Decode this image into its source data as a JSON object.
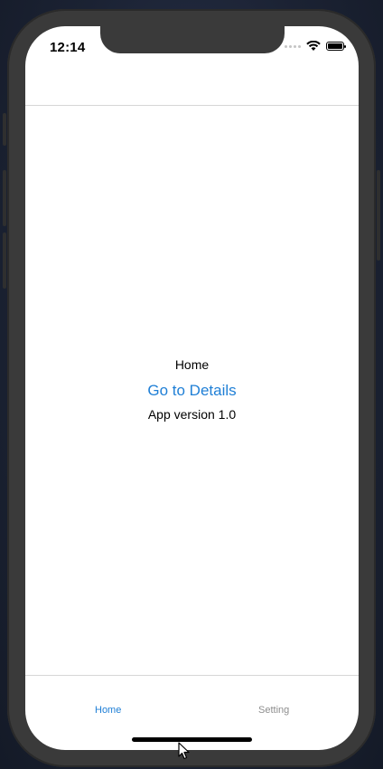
{
  "status_bar": {
    "time": "12:14"
  },
  "screen": {
    "title": "Home",
    "details_link": "Go to Details",
    "version_text": "App version 1.0"
  },
  "tab_bar": {
    "tabs": [
      {
        "label": "Home",
        "active": true
      },
      {
        "label": "Setting",
        "active": false
      }
    ]
  },
  "colors": {
    "accent": "#1f7fd6",
    "inactive_tab": "#8e8e8e"
  }
}
